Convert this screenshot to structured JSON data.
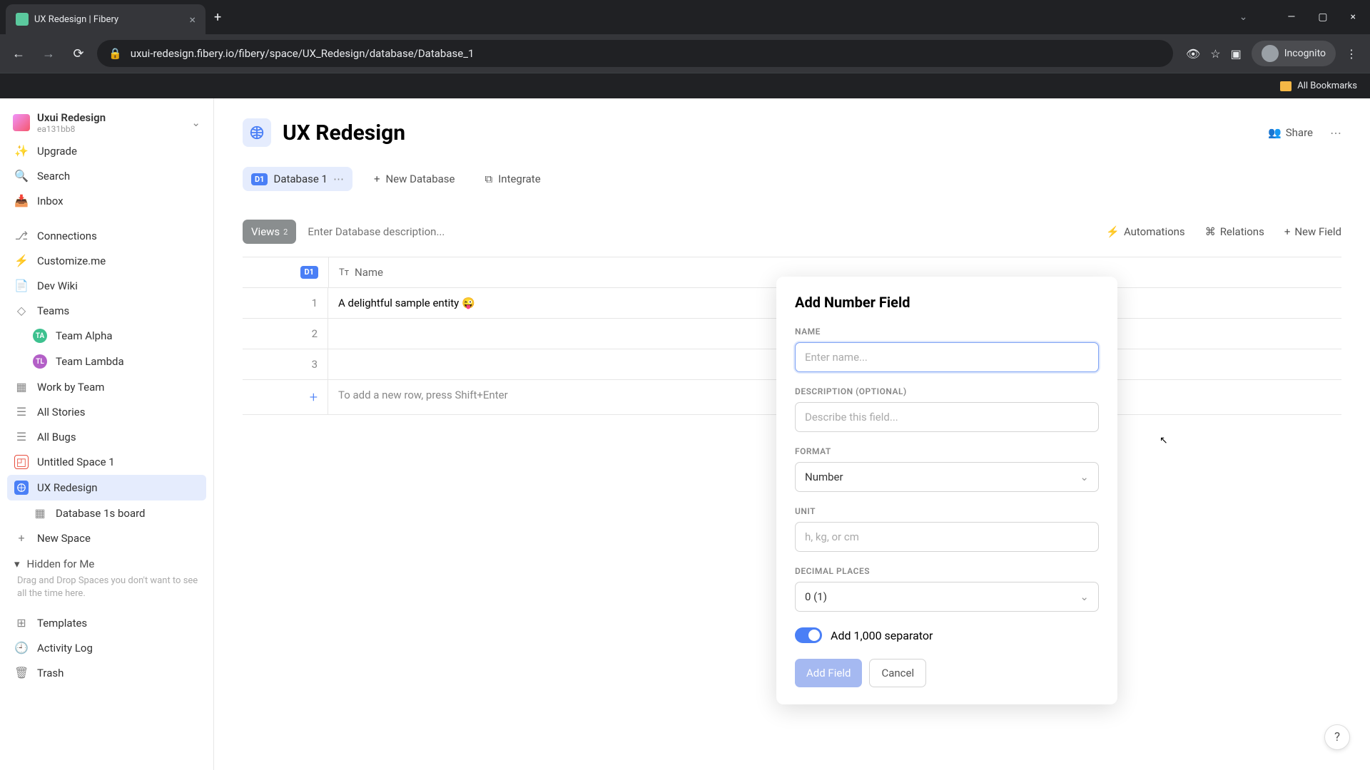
{
  "browser": {
    "tab_title": "UX Redesign | Fibery",
    "url": "uxui-redesign.fibery.io/fibery/space/UX_Redesign/database/Database_1",
    "incognito_label": "Incognito",
    "bookmarks_label": "All Bookmarks"
  },
  "sidebar": {
    "workspace_name": "Uxui Redesign",
    "workspace_id": "ea131bb8",
    "upgrade": "Upgrade",
    "search": "Search",
    "inbox": "Inbox",
    "connections": "Connections",
    "customize": "Customize.me",
    "dev_wiki": "Dev Wiki",
    "teams": "Teams",
    "team_alpha": "Team Alpha",
    "team_lambda": "Team Lambda",
    "work_by_team": "Work by Team",
    "all_stories": "All Stories",
    "all_bugs": "All Bugs",
    "untitled_space": "Untitled Space 1",
    "ux_redesign": "UX Redesign",
    "board": "Database 1s board",
    "new_space": "New Space",
    "hidden_title": "Hidden for Me",
    "hidden_caption": "Drag and Drop Spaces you don't want to see all the time here.",
    "templates": "Templates",
    "activity_log": "Activity Log",
    "trash": "Trash"
  },
  "page": {
    "title": "UX Redesign",
    "share": "Share",
    "tab_database": "Database 1",
    "new_database": "New Database",
    "integrate": "Integrate",
    "views": "Views",
    "views_count": "2",
    "desc_placeholder": "Enter Database description...",
    "automations": "Automations",
    "relations": "Relations",
    "new_field": "New Field"
  },
  "table": {
    "badge": "D1",
    "col_name": "Name",
    "rows": {
      "r1": "1",
      "r1_name": "A delightful sample entity 😜",
      "r2": "2",
      "r3": "3"
    },
    "add_hint": "To add a new row, press Shift+Enter"
  },
  "dialog": {
    "title": "Add Number Field",
    "name_label": "NAME",
    "name_placeholder": "Enter name...",
    "desc_label": "DESCRIPTION (OPTIONAL)",
    "desc_placeholder": "Describe this field...",
    "format_label": "FORMAT",
    "format_value": "Number",
    "unit_label": "UNIT",
    "unit_placeholder": "h, kg, or cm",
    "decimal_label": "DECIMAL PLACES",
    "decimal_value": "0 (1)",
    "separator_label": "Add 1,000 separator",
    "add_btn": "Add Field",
    "cancel_btn": "Cancel"
  },
  "help": "?"
}
